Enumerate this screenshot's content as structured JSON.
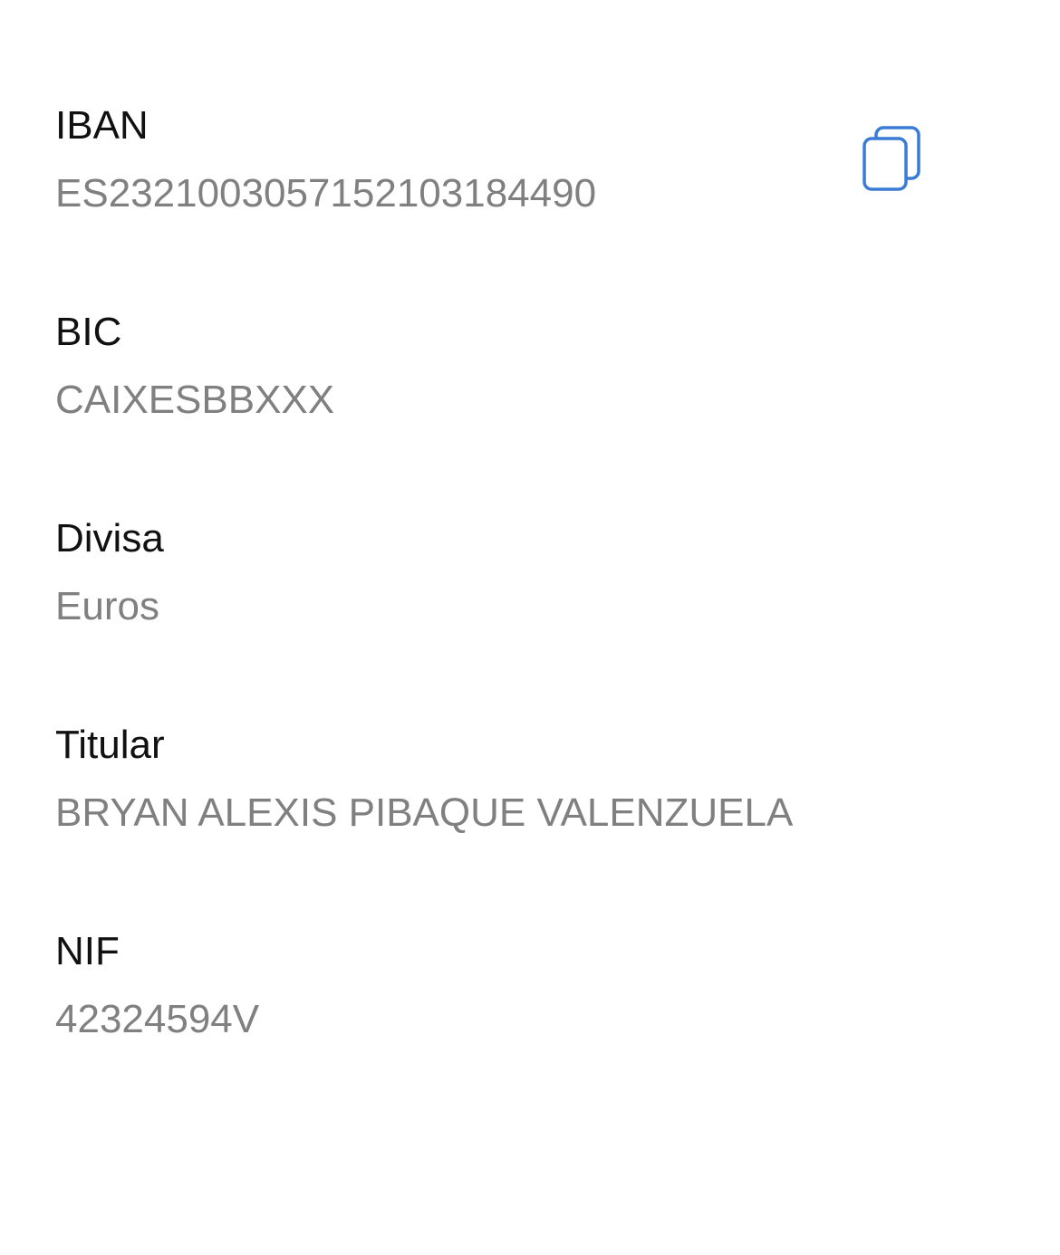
{
  "fields": [
    {
      "label": "IBAN",
      "value": "ES2321003057152103184490"
    },
    {
      "label": "BIC",
      "value": "CAIXESBBXXX"
    },
    {
      "label": "Divisa",
      "value": "Euros"
    },
    {
      "label": "Titular",
      "value": "BRYAN ALEXIS PIBAQUE VALENZUELA"
    },
    {
      "label": "NIF",
      "value": "42324594V"
    }
  ],
  "copy_button": {
    "icon": "copy-icon",
    "color": "#3a7bd5"
  },
  "colors": {
    "label": "#111111",
    "value": "#808080",
    "background": "#ffffff"
  }
}
